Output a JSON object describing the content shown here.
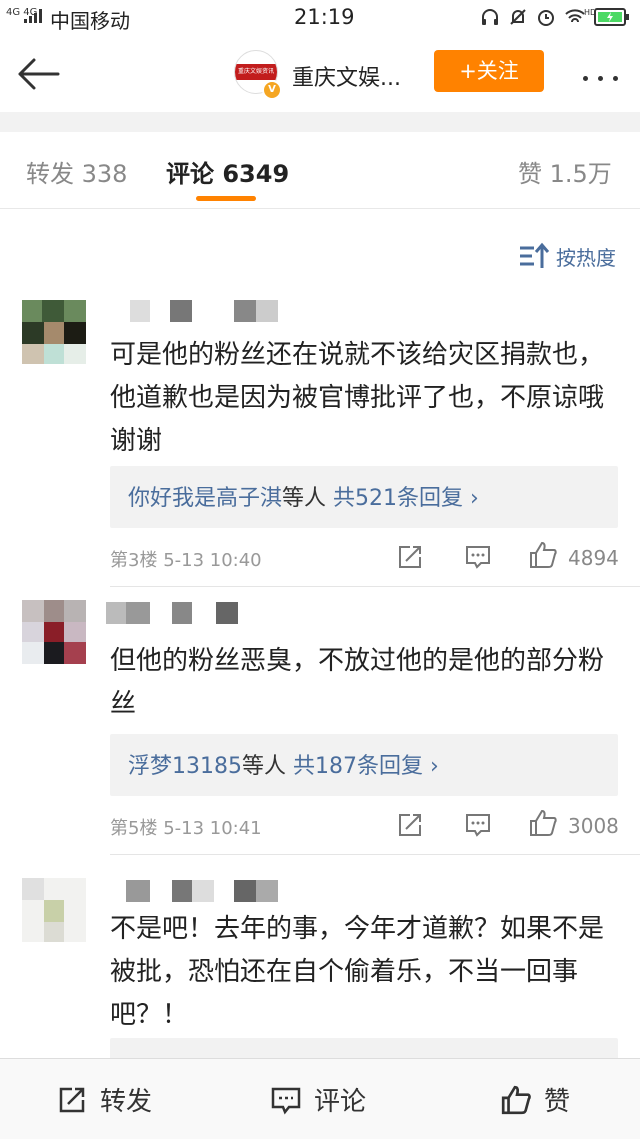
{
  "status_bar": {
    "network": "4G 4G",
    "carrier": "中国移动",
    "time": "21:19",
    "hd_label": "HD"
  },
  "nav": {
    "account_name": "重庆文娱...",
    "logo_text": "重庆文娱资讯",
    "verified_badge": "V",
    "follow_label": "+关注",
    "accent_color": "#ff8200"
  },
  "tabs": [
    {
      "label": "转发",
      "count": "338"
    },
    {
      "label": "评论",
      "count": "6349",
      "active": true
    },
    {
      "label": "赞",
      "count": "1.5万"
    }
  ],
  "sort_label": "按热度",
  "comments": [
    {
      "text": "可是他的粉丝还在说就不该给灾区捐款也，他道歉也是因为被官博批评了也，不原谅哦谢谢",
      "replies_users": "你好我是高子淇",
      "replies_suffix": "等人",
      "replies_count": "共521条回复",
      "floor": "第3楼",
      "time": "5-13 10:40",
      "likes": "4894"
    },
    {
      "text": "但他的粉丝恶臭，不放过他的是他的部分粉丝",
      "replies_users": "浮梦13185",
      "replies_suffix": "等人",
      "replies_count": "共187条回复",
      "floor": "第5楼",
      "time": "5-13 10:41",
      "likes": "3008"
    },
    {
      "text": "不是吧！去年的事，今年才道歉？如果不是被批，恐怕还在自个偷着乐，不当一回事吧？！"
    }
  ],
  "bottom_bar": {
    "repost_label": "转发",
    "comment_label": "评论",
    "like_label": "赞"
  },
  "colors": {
    "link_blue": "#4a6d9c",
    "reply_bg": "#f2f2f2"
  },
  "icons": [
    "back-arrow-icon",
    "more-icon",
    "sort-icon",
    "repost-icon",
    "comment-icon",
    "like-icon"
  ]
}
